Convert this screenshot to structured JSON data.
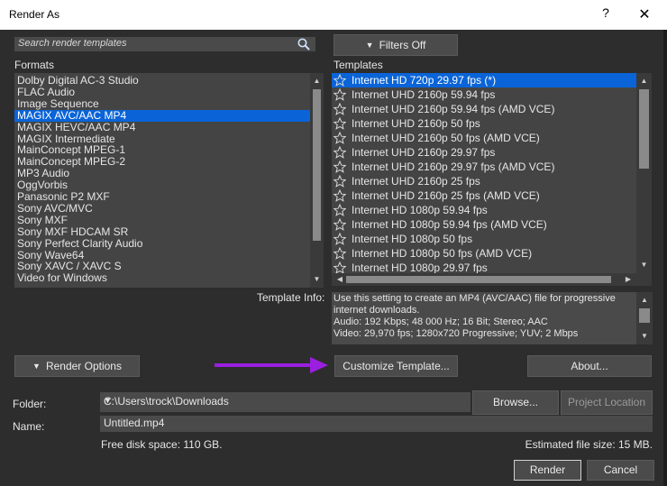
{
  "window": {
    "title": "Render As",
    "help_glyph": "?",
    "close_glyph": "✕"
  },
  "search": {
    "placeholder": "Search render templates"
  },
  "filters_button": "Filters Off",
  "formats": {
    "label": "Formats",
    "selected_index": 3,
    "items": [
      "Dolby Digital AC-3 Studio",
      "FLAC Audio",
      "Image Sequence",
      "MAGIX AVC/AAC MP4",
      "MAGIX HEVC/AAC MP4",
      "MAGIX Intermediate",
      "MainConcept MPEG-1",
      "MainConcept MPEG-2",
      "MP3 Audio",
      "OggVorbis",
      "Panasonic P2 MXF",
      "Sony AVC/MVC",
      "Sony MXF",
      "Sony MXF HDCAM SR",
      "Sony Perfect Clarity Audio",
      "Sony Wave64",
      "Sony XAVC / XAVC S",
      "Video for Windows"
    ]
  },
  "templates": {
    "label": "Templates",
    "selected_index": 0,
    "items": [
      "Internet HD 720p 29.97 fps (*)",
      "Internet UHD 2160p 59.94 fps",
      "Internet UHD 2160p 59.94 fps (AMD VCE)",
      "Internet UHD 2160p 50 fps",
      "Internet UHD 2160p 50 fps (AMD VCE)",
      "Internet UHD 2160p 29.97 fps",
      "Internet UHD 2160p 29.97 fps (AMD VCE)",
      "Internet UHD 2160p 25 fps",
      "Internet UHD 2160p 25 fps (AMD VCE)",
      "Internet HD 1080p 59.94 fps",
      "Internet HD 1080p 59.94 fps (AMD VCE)",
      "Internet HD 1080p 50 fps",
      "Internet HD 1080p 50 fps (AMD VCE)",
      "Internet HD 1080p 29.97 fps"
    ]
  },
  "template_info": {
    "label": "Template Info:",
    "lines": [
      "Use this setting to create an MP4 (AVC/AAC) file for progressive",
      "internet downloads.",
      "Audio: 192 Kbps; 48 000 Hz; 16 Bit; Stereo; AAC",
      "Video: 29,970 fps; 1280x720 Progressive; YUV; 2 Mbps"
    ]
  },
  "buttons": {
    "render_options": "Render Options",
    "customize_template": "Customize Template...",
    "about": "About...",
    "browse": "Browse...",
    "project_location": "Project Location",
    "render": "Render",
    "cancel": "Cancel"
  },
  "folder": {
    "label": "Folder:",
    "value": "C:\\Users\\trock\\Downloads"
  },
  "name": {
    "label": "Name:",
    "value": "Untitled.mp4"
  },
  "status": {
    "free_disk": "Free disk space: 110 GB.",
    "estimated_size": "Estimated file size: 15 MB."
  },
  "colors": {
    "selection": "#0a64d8",
    "annotation_arrow": "#9b1fe0"
  },
  "icons": {
    "search": "search-icon",
    "favorite": "star-outline-icon",
    "filter": "triangle-down-icon"
  }
}
